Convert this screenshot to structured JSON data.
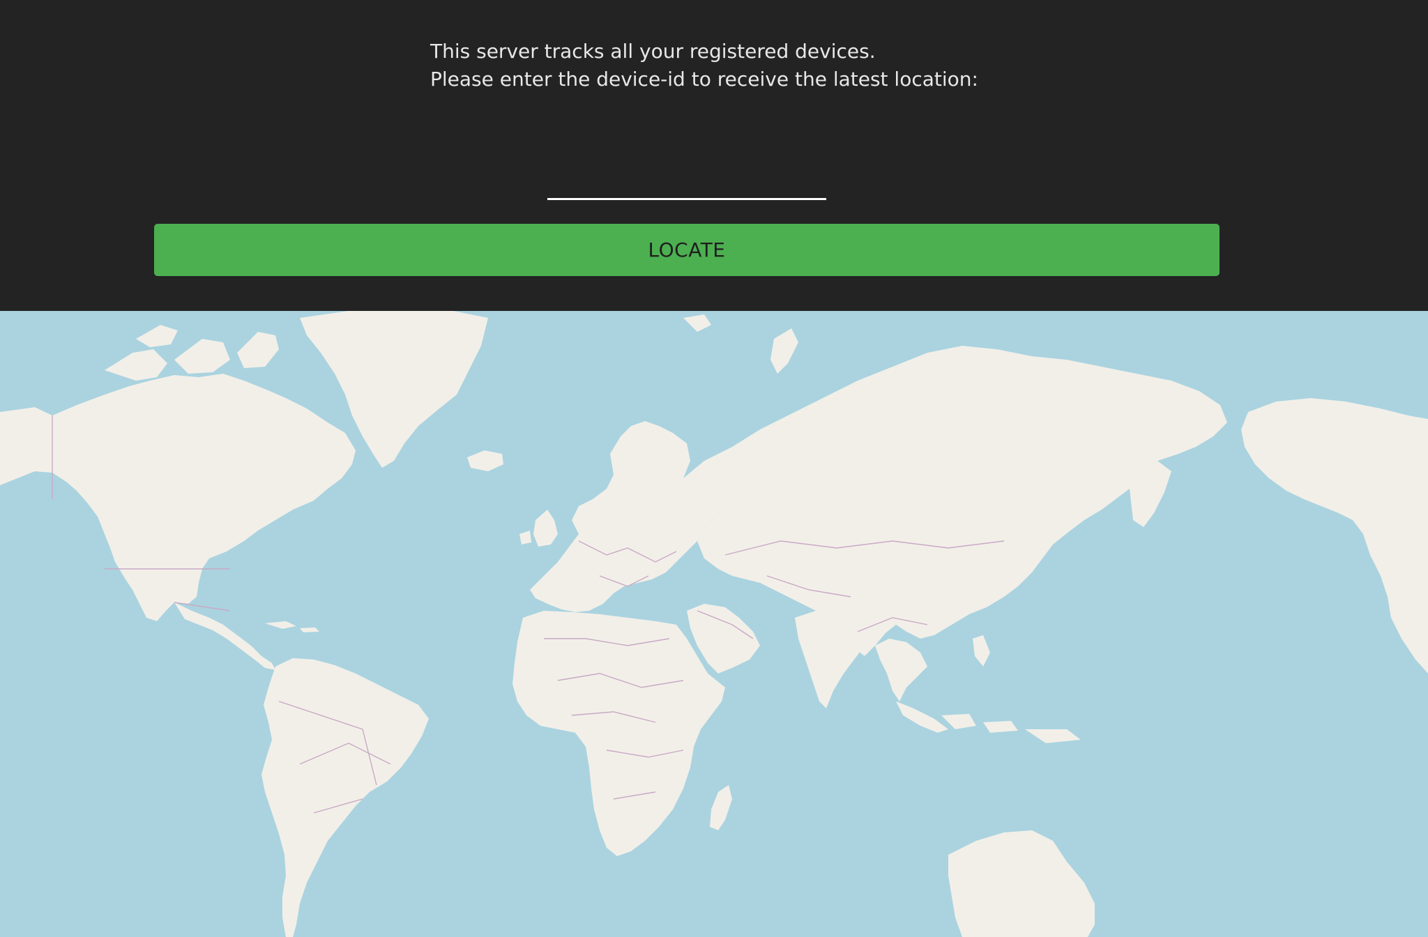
{
  "intro": {
    "line1": "This server tracks all your registered devices.",
    "line2": "Please enter the device-id to receive the latest location:"
  },
  "device_input": {
    "value": "",
    "placeholder": ""
  },
  "locate_button": {
    "label": "LOCATE"
  },
  "map": {
    "view": "world",
    "colors": {
      "water": "#aad3df",
      "land": "#f2efe9",
      "borders": "#c8a9c4"
    }
  },
  "colors": {
    "page_background": "#232323",
    "accent": "#4caf50",
    "text": "#e8e8e8"
  }
}
